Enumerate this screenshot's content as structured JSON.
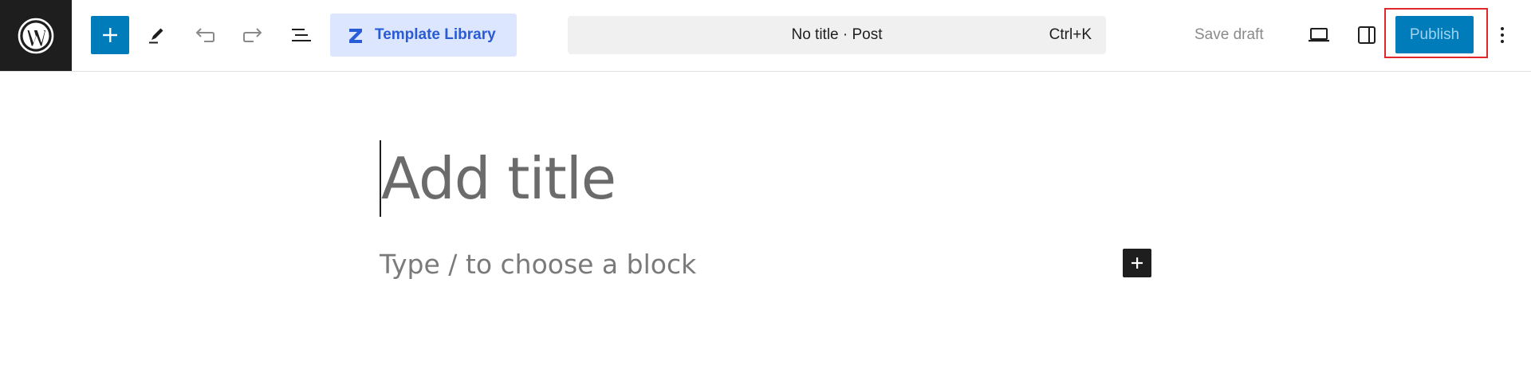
{
  "header": {
    "logo_icon": "wordpress-logo-icon",
    "inserter_icon": "plus-icon",
    "tools_icon": "pencil-icon",
    "undo_icon": "undo-icon",
    "redo_icon": "redo-icon",
    "document_overview_icon": "list-view-icon",
    "template_library": {
      "label": "Template Library",
      "icon": "template-library-logo-icon"
    },
    "command_bar": {
      "title": "No title · Post",
      "shortcut": "Ctrl+K"
    },
    "save_draft_label": "Save draft",
    "preview_icon": "laptop-icon",
    "settings_icon": "sidebar-toggle-icon",
    "publish_label": "Publish",
    "options_icon": "more-vertical-icon"
  },
  "editor": {
    "title_placeholder": "Add title",
    "block_placeholder": "Type / to choose a block",
    "add_block_icon": "plus-icon"
  },
  "colors": {
    "accent": "#007cba",
    "template_library_bg": "#dce6ff",
    "template_library_text": "#2a5bd7",
    "highlight": "#e0282c"
  }
}
